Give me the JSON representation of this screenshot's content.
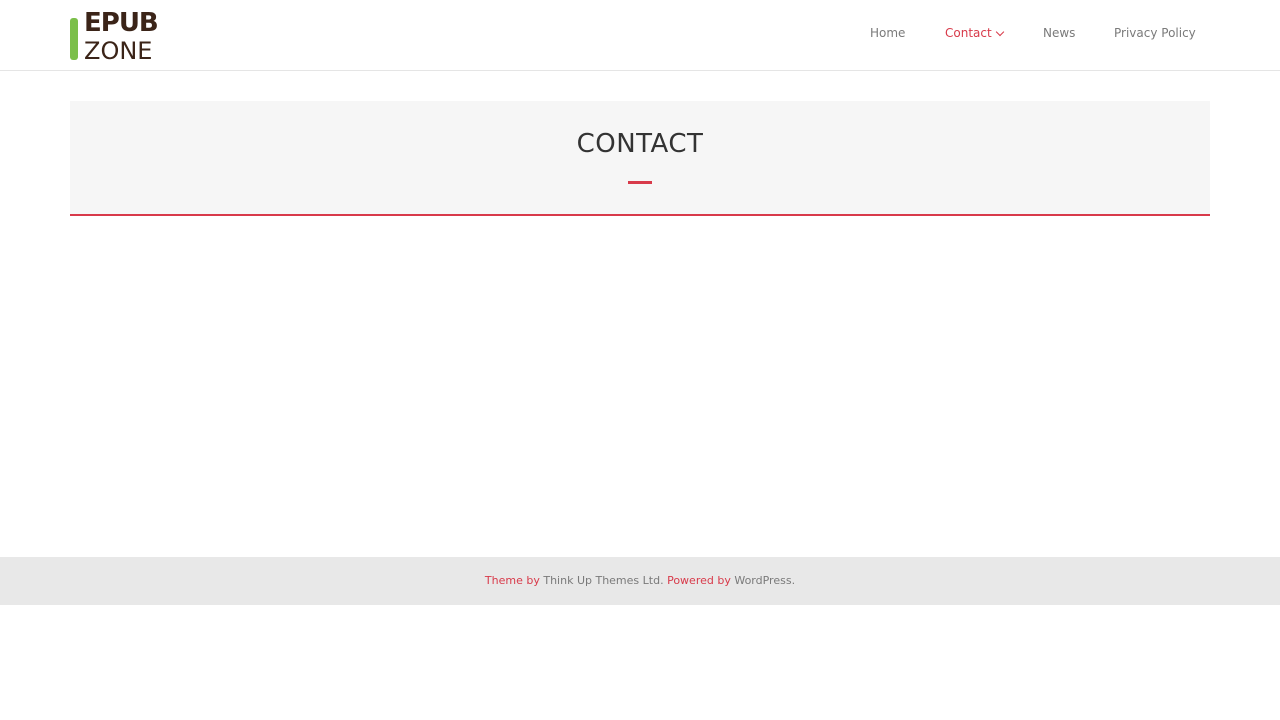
{
  "site": {
    "logo": {
      "line1": "EPUB",
      "line2": "ZONE"
    }
  },
  "nav": {
    "items": [
      {
        "label": "Home"
      },
      {
        "label": "Contact"
      },
      {
        "label": "News"
      },
      {
        "label": "Privacy Policy"
      }
    ],
    "active_index": 1
  },
  "banner": {
    "title": "CONTACT"
  },
  "footer": {
    "theme_prefix": "Theme by",
    "theme_author": "Think Up Themes Ltd.",
    "powered_prefix": "Powered by",
    "powered_name": "WordPress."
  },
  "colors": {
    "accent": "#d83a4a",
    "logo_text": "#3b2418",
    "logo_bar": "#7bbf4a",
    "footer_bg": "#e8e8e8"
  }
}
